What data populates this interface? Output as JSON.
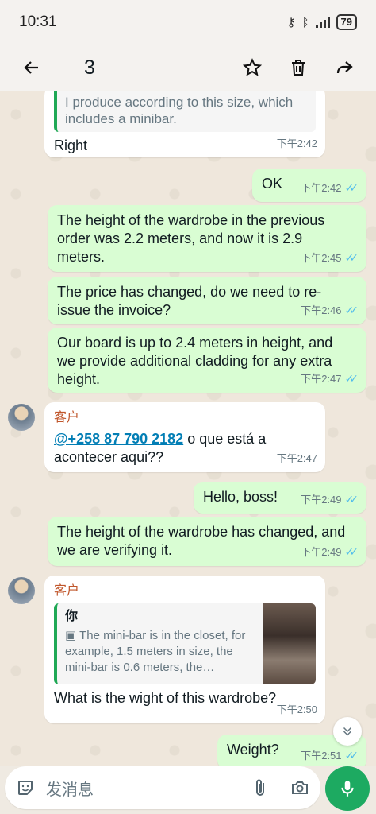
{
  "status": {
    "time": "10:31",
    "battery": "79"
  },
  "header": {
    "selected_count": "3"
  },
  "messages": {
    "m1_quote": "I produce according to this size, which includes a minibar.",
    "m1_text": "Right",
    "m1_time": "下午2:42",
    "m2_text": "OK",
    "m2_time": "下午2:42",
    "m3_text": "The height of the wardrobe in the previous order was 2.2 meters, and now it is 2.9 meters.",
    "m3_time": "下午2:45",
    "m4_text": "The price has changed, do we need to re-issue the invoice?",
    "m4_time": "下午2:46",
    "m5_text": "Our board is up to 2.4 meters in height, and we provide additional cladding for any extra height.",
    "m5_time": "下午2:47",
    "m6_sender": "客户",
    "m6_mention": "@+258 87 790 2182",
    "m6_text": " o que está a acontecer aqui??",
    "m6_time": "下午2:47",
    "m7_text": "Hello, boss!",
    "m7_time": "下午2:49",
    "m8_text": "The height of the wardrobe has changed, and we are verifying it.",
    "m8_time": "下午2:49",
    "m9_sender": "客户",
    "m9_quote_author": "你",
    "m9_quote_text": "The mini-bar is in the closet, for example, 1.5 meters in size, the mini-bar is 0.6 meters, the…",
    "m9_text": "What is the wight of this wardrobe?",
    "m9_time": "下午2:50",
    "m10_text": "Weight?",
    "m10_time": "下午2:51"
  },
  "input": {
    "placeholder": "发消息"
  },
  "colors": {
    "accent": "#1daa61",
    "outgoing_bubble": "#d9fdd3",
    "incoming_bubble": "#ffffff",
    "ticks": "#53bdeb",
    "sender": "#c0562b",
    "mention": "#027eb5"
  }
}
